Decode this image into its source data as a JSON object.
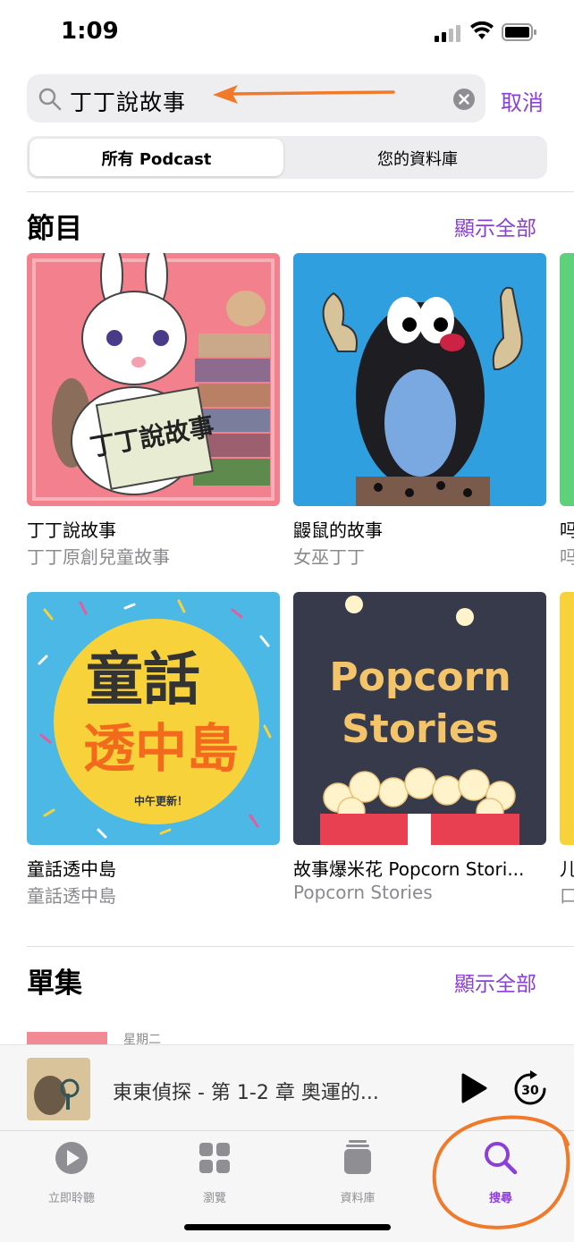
{
  "status_bar": {
    "time": "1:09"
  },
  "search": {
    "query": "丁丁說故事",
    "cancel_label": "取消"
  },
  "segments": {
    "all_podcasts": "所有 Podcast",
    "your_library": "您的資料庫"
  },
  "shows_section": {
    "title": "節目",
    "see_all": "顯示全部",
    "items": [
      {
        "title": "丁丁說故事",
        "subtitle": "丁丁原創兒童故事",
        "art_text": "丁丁說故事"
      },
      {
        "title": "鼹鼠的故事",
        "subtitle": "女巫丁丁"
      },
      {
        "title": "吗",
        "subtitle": "吗"
      },
      {
        "title": "童話透中島",
        "subtitle": "童話透中島",
        "art_text_1": "童話",
        "art_text_2": "透中島",
        "art_tag": "中午更新！"
      },
      {
        "title": "故事爆米花 Popcorn Stori...",
        "subtitle": "Popcorn Stories",
        "art_text_1": "Popcorn",
        "art_text_2": "Stories"
      },
      {
        "title": "儿",
        "subtitle": "口"
      }
    ]
  },
  "episodes_section": {
    "title": "單集",
    "see_all": "顯示全部",
    "first_date": "星期二"
  },
  "mini_player": {
    "title": "東東偵探 - 第 1-2 章 奧運的...",
    "skip_label": "30"
  },
  "tab_bar": {
    "items": [
      {
        "label": "立即聆聽",
        "icon": "play-circle-icon"
      },
      {
        "label": "瀏覽",
        "icon": "grid-icon"
      },
      {
        "label": "資料庫",
        "icon": "library-stack-icon"
      },
      {
        "label": "搜尋",
        "icon": "search-icon",
        "active": true
      }
    ]
  },
  "colors": {
    "accent": "#8a3fd6",
    "annotation": "#f07a2a"
  }
}
